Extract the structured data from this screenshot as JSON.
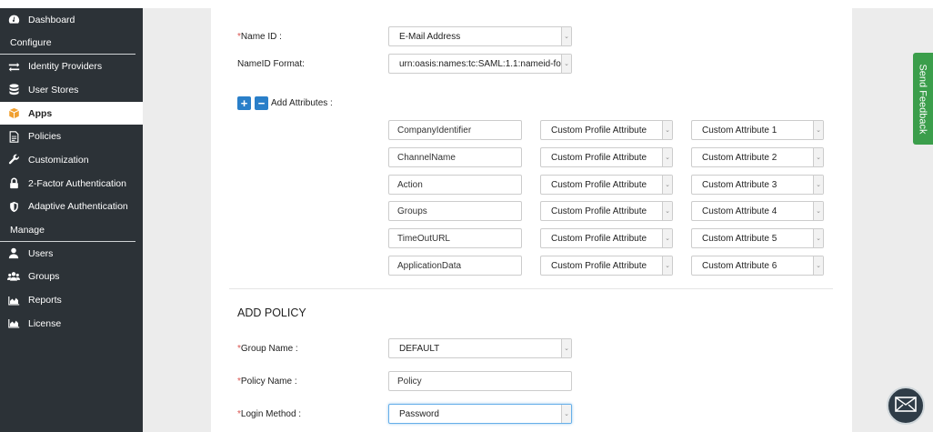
{
  "sidebar": {
    "dashboard": "Dashboard",
    "configure_header": "Configure",
    "configure_items": [
      "Identity Providers",
      "User Stores",
      "Apps",
      "Policies",
      "Customization",
      "2-Factor Authentication",
      "Adaptive Authentication"
    ],
    "manage_header": "Manage",
    "manage_items": [
      "Users",
      "Groups",
      "Reports",
      "License"
    ],
    "active_item": "Apps"
  },
  "form": {
    "name_id": {
      "label": "Name ID :",
      "value": "E-Mail Address"
    },
    "nameid_format": {
      "label": "NameID Format:",
      "value": "urn:oasis:names:tc:SAML:1.1:nameid-format"
    },
    "add_attributes_label": "Add Attributes :",
    "attributes": [
      {
        "name": "CompanyIdentifier",
        "type": "Custom Profile Attribute",
        "target": "Custom Attribute 1"
      },
      {
        "name": "ChannelName",
        "type": "Custom Profile Attribute",
        "target": "Custom Attribute 2"
      },
      {
        "name": "Action",
        "type": "Custom Profile Attribute",
        "target": "Custom Attribute 3"
      },
      {
        "name": "Groups",
        "type": "Custom Profile Attribute",
        "target": "Custom Attribute 4"
      },
      {
        "name": "TimeOutURL",
        "type": "Custom Profile Attribute",
        "target": "Custom Attribute 5"
      },
      {
        "name": "ApplicationData",
        "type": "Custom Profile Attribute",
        "target": "Custom Attribute 6"
      }
    ]
  },
  "policy": {
    "title": "ADD POLICY",
    "group_name": {
      "label": "Group Name :",
      "value": "DEFAULT"
    },
    "policy_name": {
      "label": "Policy Name :",
      "value": "Policy"
    },
    "login_method": {
      "label": "Login Method :",
      "value": "Password"
    }
  },
  "feedback_label": "Send Feedback",
  "colors": {
    "sidebar_bg": "#2c3237",
    "accent_blue": "#2a7fc9",
    "feedback_green": "#3b9e4b",
    "required_red": "#d9534f"
  }
}
